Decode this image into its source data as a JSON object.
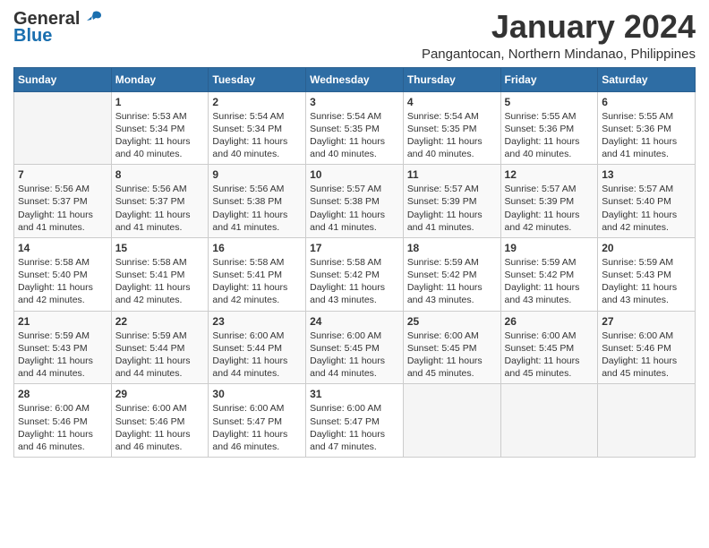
{
  "header": {
    "logo_general": "General",
    "logo_blue": "Blue",
    "title": "January 2024",
    "subtitle": "Pangantocan, Northern Mindanao, Philippines"
  },
  "weekdays": [
    "Sunday",
    "Monday",
    "Tuesday",
    "Wednesday",
    "Thursday",
    "Friday",
    "Saturday"
  ],
  "weeks": [
    [
      {
        "day": "",
        "sunrise": "",
        "sunset": "",
        "daylight": ""
      },
      {
        "day": "1",
        "sunrise": "Sunrise: 5:53 AM",
        "sunset": "Sunset: 5:34 PM",
        "daylight": "Daylight: 11 hours and 40 minutes."
      },
      {
        "day": "2",
        "sunrise": "Sunrise: 5:54 AM",
        "sunset": "Sunset: 5:34 PM",
        "daylight": "Daylight: 11 hours and 40 minutes."
      },
      {
        "day": "3",
        "sunrise": "Sunrise: 5:54 AM",
        "sunset": "Sunset: 5:35 PM",
        "daylight": "Daylight: 11 hours and 40 minutes."
      },
      {
        "day": "4",
        "sunrise": "Sunrise: 5:54 AM",
        "sunset": "Sunset: 5:35 PM",
        "daylight": "Daylight: 11 hours and 40 minutes."
      },
      {
        "day": "5",
        "sunrise": "Sunrise: 5:55 AM",
        "sunset": "Sunset: 5:36 PM",
        "daylight": "Daylight: 11 hours and 40 minutes."
      },
      {
        "day": "6",
        "sunrise": "Sunrise: 5:55 AM",
        "sunset": "Sunset: 5:36 PM",
        "daylight": "Daylight: 11 hours and 41 minutes."
      }
    ],
    [
      {
        "day": "7",
        "sunrise": "Sunrise: 5:56 AM",
        "sunset": "Sunset: 5:37 PM",
        "daylight": "Daylight: 11 hours and 41 minutes."
      },
      {
        "day": "8",
        "sunrise": "Sunrise: 5:56 AM",
        "sunset": "Sunset: 5:37 PM",
        "daylight": "Daylight: 11 hours and 41 minutes."
      },
      {
        "day": "9",
        "sunrise": "Sunrise: 5:56 AM",
        "sunset": "Sunset: 5:38 PM",
        "daylight": "Daylight: 11 hours and 41 minutes."
      },
      {
        "day": "10",
        "sunrise": "Sunrise: 5:57 AM",
        "sunset": "Sunset: 5:38 PM",
        "daylight": "Daylight: 11 hours and 41 minutes."
      },
      {
        "day": "11",
        "sunrise": "Sunrise: 5:57 AM",
        "sunset": "Sunset: 5:39 PM",
        "daylight": "Daylight: 11 hours and 41 minutes."
      },
      {
        "day": "12",
        "sunrise": "Sunrise: 5:57 AM",
        "sunset": "Sunset: 5:39 PM",
        "daylight": "Daylight: 11 hours and 42 minutes."
      },
      {
        "day": "13",
        "sunrise": "Sunrise: 5:57 AM",
        "sunset": "Sunset: 5:40 PM",
        "daylight": "Daylight: 11 hours and 42 minutes."
      }
    ],
    [
      {
        "day": "14",
        "sunrise": "Sunrise: 5:58 AM",
        "sunset": "Sunset: 5:40 PM",
        "daylight": "Daylight: 11 hours and 42 minutes."
      },
      {
        "day": "15",
        "sunrise": "Sunrise: 5:58 AM",
        "sunset": "Sunset: 5:41 PM",
        "daylight": "Daylight: 11 hours and 42 minutes."
      },
      {
        "day": "16",
        "sunrise": "Sunrise: 5:58 AM",
        "sunset": "Sunset: 5:41 PM",
        "daylight": "Daylight: 11 hours and 42 minutes."
      },
      {
        "day": "17",
        "sunrise": "Sunrise: 5:58 AM",
        "sunset": "Sunset: 5:42 PM",
        "daylight": "Daylight: 11 hours and 43 minutes."
      },
      {
        "day": "18",
        "sunrise": "Sunrise: 5:59 AM",
        "sunset": "Sunset: 5:42 PM",
        "daylight": "Daylight: 11 hours and 43 minutes."
      },
      {
        "day": "19",
        "sunrise": "Sunrise: 5:59 AM",
        "sunset": "Sunset: 5:42 PM",
        "daylight": "Daylight: 11 hours and 43 minutes."
      },
      {
        "day": "20",
        "sunrise": "Sunrise: 5:59 AM",
        "sunset": "Sunset: 5:43 PM",
        "daylight": "Daylight: 11 hours and 43 minutes."
      }
    ],
    [
      {
        "day": "21",
        "sunrise": "Sunrise: 5:59 AM",
        "sunset": "Sunset: 5:43 PM",
        "daylight": "Daylight: 11 hours and 44 minutes."
      },
      {
        "day": "22",
        "sunrise": "Sunrise: 5:59 AM",
        "sunset": "Sunset: 5:44 PM",
        "daylight": "Daylight: 11 hours and 44 minutes."
      },
      {
        "day": "23",
        "sunrise": "Sunrise: 6:00 AM",
        "sunset": "Sunset: 5:44 PM",
        "daylight": "Daylight: 11 hours and 44 minutes."
      },
      {
        "day": "24",
        "sunrise": "Sunrise: 6:00 AM",
        "sunset": "Sunset: 5:45 PM",
        "daylight": "Daylight: 11 hours and 44 minutes."
      },
      {
        "day": "25",
        "sunrise": "Sunrise: 6:00 AM",
        "sunset": "Sunset: 5:45 PM",
        "daylight": "Daylight: 11 hours and 45 minutes."
      },
      {
        "day": "26",
        "sunrise": "Sunrise: 6:00 AM",
        "sunset": "Sunset: 5:45 PM",
        "daylight": "Daylight: 11 hours and 45 minutes."
      },
      {
        "day": "27",
        "sunrise": "Sunrise: 6:00 AM",
        "sunset": "Sunset: 5:46 PM",
        "daylight": "Daylight: 11 hours and 45 minutes."
      }
    ],
    [
      {
        "day": "28",
        "sunrise": "Sunrise: 6:00 AM",
        "sunset": "Sunset: 5:46 PM",
        "daylight": "Daylight: 11 hours and 46 minutes."
      },
      {
        "day": "29",
        "sunrise": "Sunrise: 6:00 AM",
        "sunset": "Sunset: 5:46 PM",
        "daylight": "Daylight: 11 hours and 46 minutes."
      },
      {
        "day": "30",
        "sunrise": "Sunrise: 6:00 AM",
        "sunset": "Sunset: 5:47 PM",
        "daylight": "Daylight: 11 hours and 46 minutes."
      },
      {
        "day": "31",
        "sunrise": "Sunrise: 6:00 AM",
        "sunset": "Sunset: 5:47 PM",
        "daylight": "Daylight: 11 hours and 47 minutes."
      },
      {
        "day": "",
        "sunrise": "",
        "sunset": "",
        "daylight": ""
      },
      {
        "day": "",
        "sunrise": "",
        "sunset": "",
        "daylight": ""
      },
      {
        "day": "",
        "sunrise": "",
        "sunset": "",
        "daylight": ""
      }
    ]
  ]
}
